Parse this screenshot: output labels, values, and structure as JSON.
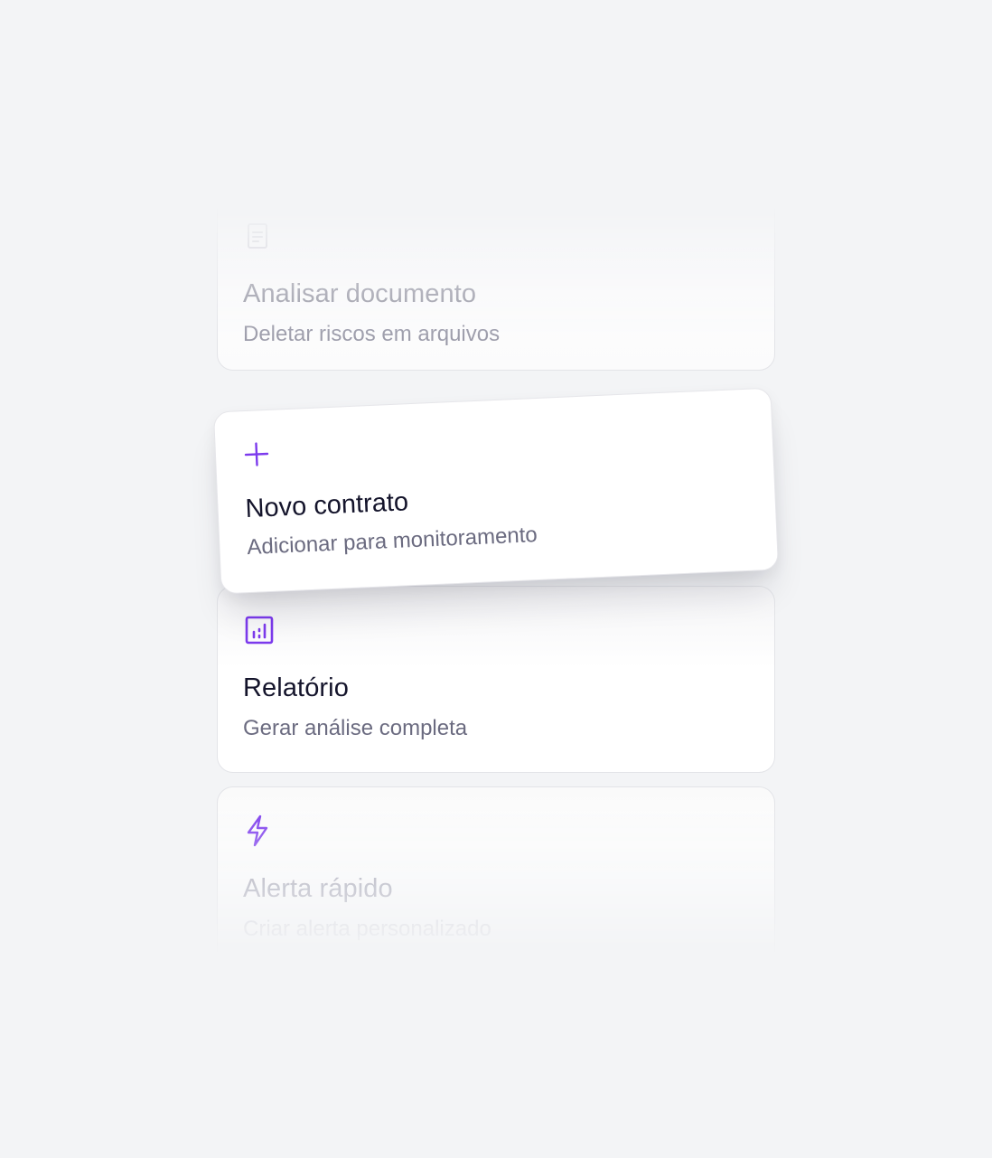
{
  "accent_color": "#7c3aed",
  "cards": [
    {
      "id": "analisar",
      "icon": "document-icon",
      "title": "Analisar documento",
      "subtitle": "Deletar riscos em arquivos"
    },
    {
      "id": "novo",
      "icon": "plus-icon",
      "title": "Novo contrato",
      "subtitle": "Adicionar para monitoramento"
    },
    {
      "id": "relatorio",
      "icon": "bar-chart-icon",
      "title": "Relatório",
      "subtitle": "Gerar análise completa"
    },
    {
      "id": "alerta",
      "icon": "lightning-icon",
      "title": "Alerta rápido",
      "subtitle": "Criar alerta personalizado"
    }
  ]
}
